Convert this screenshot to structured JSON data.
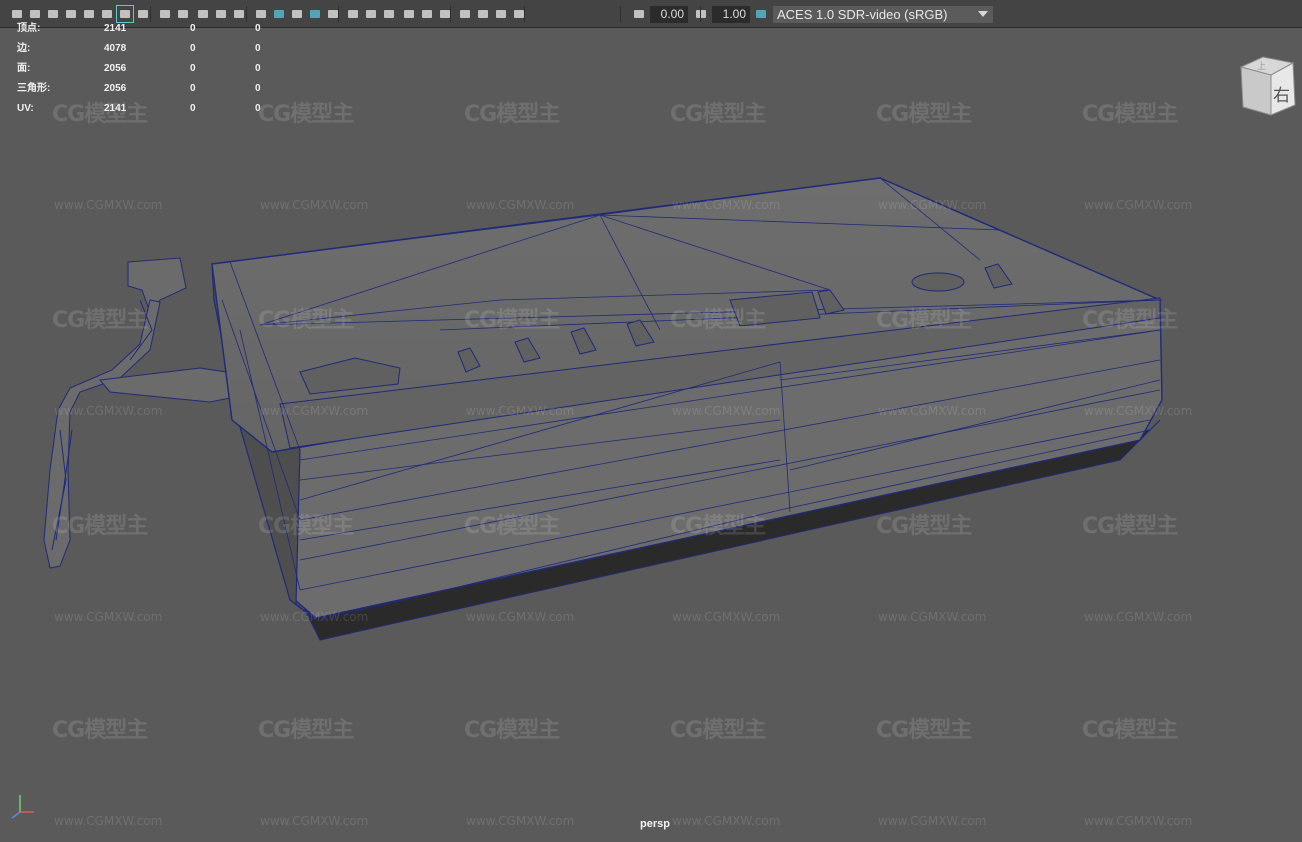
{
  "toolbar": {
    "icons": [
      "camera-icon",
      "camera-lock-icon",
      "camera-attributes-icon",
      "bookmark-icon",
      "image-plane-icon",
      "2d-pan-zoom-icon",
      "grease-pencil-icon",
      "grid-icon",
      "film-gate-icon",
      "resolution-gate-icon",
      "gate-mask-icon",
      "field-chart-icon",
      "safe-action-icon",
      "wireframe-icon",
      "smooth-shade-icon",
      "default-material-icon",
      "wireframe-on-shaded-icon",
      "textured-icon",
      "use-lights-icon",
      "shadows-icon",
      "screen-space-ao-icon",
      "motion-blur-icon",
      "multisample-aa-icon",
      "depth-of-field-icon",
      "isolate-select-icon",
      "xray-icon",
      "xray-joints-icon",
      "xray-active-icon",
      "exposure-icon",
      "gamma-icon",
      "color-management-icon"
    ],
    "exposure_value": "0.00",
    "gamma_value": "1.00",
    "color_space": "ACES 1.0 SDR-video (sRGB)",
    "accent": "#5ec8d6"
  },
  "hud": {
    "rows": [
      {
        "label": "顶点:",
        "values": [
          "2141",
          "0",
          "0"
        ]
      },
      {
        "label": "边:",
        "values": [
          "4078",
          "0",
          "0"
        ]
      },
      {
        "label": "面:",
        "values": [
          "2056",
          "0",
          "0"
        ]
      },
      {
        "label": "三角形:",
        "values": [
          "2056",
          "0",
          "0"
        ]
      },
      {
        "label": "UV:",
        "values": [
          "2141",
          "0",
          "0"
        ]
      }
    ]
  },
  "viewcube": {
    "top_face": "上",
    "front_face": "右"
  },
  "camera": "persp",
  "axis": {
    "x": "x",
    "y": "y",
    "z": "z"
  },
  "watermark": {
    "logo": "CG模型主",
    "url": "www.CGMXW.com"
  },
  "colors": {
    "background": "#5a5a5a",
    "wire": "#1f2a7a",
    "mesh": "#6b6b6b"
  }
}
